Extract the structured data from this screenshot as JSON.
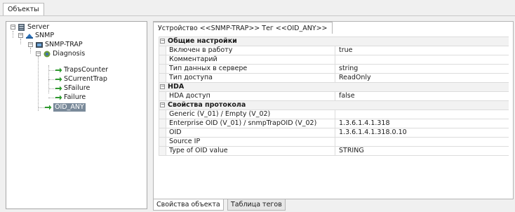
{
  "top_tab": {
    "label": "Объекты"
  },
  "tree": {
    "server": "Server",
    "snmp": "SNMP",
    "snmp_trap": "SNMP-TRAP",
    "diagnosis": "Diagnosis",
    "traps_counter": "TrapsCounter",
    "scurrent_trap": "SCurrentTrap",
    "sfailure": "SFailure",
    "failure": "Failure",
    "oid_any": "OID_ANY"
  },
  "device_tab": {
    "label": "Устройство <<SNMP-TRAP>> Тег  <<OID_ANY>>"
  },
  "properties": {
    "general": {
      "header": "Общие настройки",
      "enabled_label": "Включен в работу",
      "enabled_value": "true",
      "comment_label": "Комментарий",
      "comment_value": "",
      "datatype_label": "Тип данных в сервере",
      "datatype_value": "string",
      "access_label": "Тип доступа",
      "access_value": "ReadOnly"
    },
    "hda": {
      "header": "HDA",
      "access_label": "HDA доступ",
      "access_value": "false"
    },
    "protocol": {
      "header": "Свойства протокола",
      "generic_label": "Generic (V_01) / Empty (V_02)",
      "generic_value": "",
      "enterprise_label": "Enterprise OID (V_01) / snmpTrapOID (V_02)",
      "enterprise_value": "1.3.6.1.4.1.318",
      "oid_label": "OID",
      "oid_value": "1.3.6.1.4.1.318.0.10",
      "source_ip_label": "Source IP",
      "source_ip_value": "",
      "oid_type_label": "Type of OID value",
      "oid_type_value": "STRING"
    }
  },
  "bottom_tabs": {
    "object_props": "Свойства объекта",
    "tag_table": "Таблица тегов"
  },
  "colors": {
    "selection_bg": "#7a8a9a",
    "tag_arrow": "#2e9a2e"
  }
}
